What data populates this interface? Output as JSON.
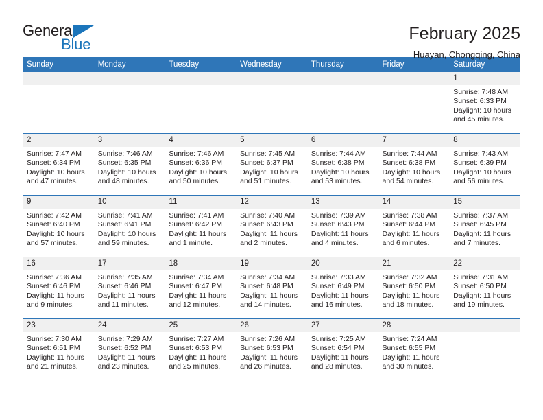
{
  "brand": {
    "name_part1": "General",
    "name_part2": "Blue"
  },
  "header": {
    "title": "February 2025",
    "subtitle": "Huayan, Chongqing, China"
  },
  "theme": {
    "header_blue": "#2f76b8",
    "brand_blue": "#1b75bb",
    "daynum_band": "#f0f0f0",
    "text": "#231f20"
  },
  "weekdays": [
    "Sunday",
    "Monday",
    "Tuesday",
    "Wednesday",
    "Thursday",
    "Friday",
    "Saturday"
  ],
  "weeks": [
    [
      {
        "day": "",
        "empty": true
      },
      {
        "day": "",
        "empty": true
      },
      {
        "day": "",
        "empty": true
      },
      {
        "day": "",
        "empty": true
      },
      {
        "day": "",
        "empty": true
      },
      {
        "day": "",
        "empty": true
      },
      {
        "day": "1",
        "sunrise": "Sunrise: 7:48 AM",
        "sunset": "Sunset: 6:33 PM",
        "daylight": "Daylight: 10 hours and 45 minutes."
      }
    ],
    [
      {
        "day": "2",
        "sunrise": "Sunrise: 7:47 AM",
        "sunset": "Sunset: 6:34 PM",
        "daylight": "Daylight: 10 hours and 47 minutes."
      },
      {
        "day": "3",
        "sunrise": "Sunrise: 7:46 AM",
        "sunset": "Sunset: 6:35 PM",
        "daylight": "Daylight: 10 hours and 48 minutes."
      },
      {
        "day": "4",
        "sunrise": "Sunrise: 7:46 AM",
        "sunset": "Sunset: 6:36 PM",
        "daylight": "Daylight: 10 hours and 50 minutes."
      },
      {
        "day": "5",
        "sunrise": "Sunrise: 7:45 AM",
        "sunset": "Sunset: 6:37 PM",
        "daylight": "Daylight: 10 hours and 51 minutes."
      },
      {
        "day": "6",
        "sunrise": "Sunrise: 7:44 AM",
        "sunset": "Sunset: 6:38 PM",
        "daylight": "Daylight: 10 hours and 53 minutes."
      },
      {
        "day": "7",
        "sunrise": "Sunrise: 7:44 AM",
        "sunset": "Sunset: 6:38 PM",
        "daylight": "Daylight: 10 hours and 54 minutes."
      },
      {
        "day": "8",
        "sunrise": "Sunrise: 7:43 AM",
        "sunset": "Sunset: 6:39 PM",
        "daylight": "Daylight: 10 hours and 56 minutes."
      }
    ],
    [
      {
        "day": "9",
        "sunrise": "Sunrise: 7:42 AM",
        "sunset": "Sunset: 6:40 PM",
        "daylight": "Daylight: 10 hours and 57 minutes."
      },
      {
        "day": "10",
        "sunrise": "Sunrise: 7:41 AM",
        "sunset": "Sunset: 6:41 PM",
        "daylight": "Daylight: 10 hours and 59 minutes."
      },
      {
        "day": "11",
        "sunrise": "Sunrise: 7:41 AM",
        "sunset": "Sunset: 6:42 PM",
        "daylight": "Daylight: 11 hours and 1 minute."
      },
      {
        "day": "12",
        "sunrise": "Sunrise: 7:40 AM",
        "sunset": "Sunset: 6:43 PM",
        "daylight": "Daylight: 11 hours and 2 minutes."
      },
      {
        "day": "13",
        "sunrise": "Sunrise: 7:39 AM",
        "sunset": "Sunset: 6:43 PM",
        "daylight": "Daylight: 11 hours and 4 minutes."
      },
      {
        "day": "14",
        "sunrise": "Sunrise: 7:38 AM",
        "sunset": "Sunset: 6:44 PM",
        "daylight": "Daylight: 11 hours and 6 minutes."
      },
      {
        "day": "15",
        "sunrise": "Sunrise: 7:37 AM",
        "sunset": "Sunset: 6:45 PM",
        "daylight": "Daylight: 11 hours and 7 minutes."
      }
    ],
    [
      {
        "day": "16",
        "sunrise": "Sunrise: 7:36 AM",
        "sunset": "Sunset: 6:46 PM",
        "daylight": "Daylight: 11 hours and 9 minutes."
      },
      {
        "day": "17",
        "sunrise": "Sunrise: 7:35 AM",
        "sunset": "Sunset: 6:46 PM",
        "daylight": "Daylight: 11 hours and 11 minutes."
      },
      {
        "day": "18",
        "sunrise": "Sunrise: 7:34 AM",
        "sunset": "Sunset: 6:47 PM",
        "daylight": "Daylight: 11 hours and 12 minutes."
      },
      {
        "day": "19",
        "sunrise": "Sunrise: 7:34 AM",
        "sunset": "Sunset: 6:48 PM",
        "daylight": "Daylight: 11 hours and 14 minutes."
      },
      {
        "day": "20",
        "sunrise": "Sunrise: 7:33 AM",
        "sunset": "Sunset: 6:49 PM",
        "daylight": "Daylight: 11 hours and 16 minutes."
      },
      {
        "day": "21",
        "sunrise": "Sunrise: 7:32 AM",
        "sunset": "Sunset: 6:50 PM",
        "daylight": "Daylight: 11 hours and 18 minutes."
      },
      {
        "day": "22",
        "sunrise": "Sunrise: 7:31 AM",
        "sunset": "Sunset: 6:50 PM",
        "daylight": "Daylight: 11 hours and 19 minutes."
      }
    ],
    [
      {
        "day": "23",
        "sunrise": "Sunrise: 7:30 AM",
        "sunset": "Sunset: 6:51 PM",
        "daylight": "Daylight: 11 hours and 21 minutes."
      },
      {
        "day": "24",
        "sunrise": "Sunrise: 7:29 AM",
        "sunset": "Sunset: 6:52 PM",
        "daylight": "Daylight: 11 hours and 23 minutes."
      },
      {
        "day": "25",
        "sunrise": "Sunrise: 7:27 AM",
        "sunset": "Sunset: 6:53 PM",
        "daylight": "Daylight: 11 hours and 25 minutes."
      },
      {
        "day": "26",
        "sunrise": "Sunrise: 7:26 AM",
        "sunset": "Sunset: 6:53 PM",
        "daylight": "Daylight: 11 hours and 26 minutes."
      },
      {
        "day": "27",
        "sunrise": "Sunrise: 7:25 AM",
        "sunset": "Sunset: 6:54 PM",
        "daylight": "Daylight: 11 hours and 28 minutes."
      },
      {
        "day": "28",
        "sunrise": "Sunrise: 7:24 AM",
        "sunset": "Sunset: 6:55 PM",
        "daylight": "Daylight: 11 hours and 30 minutes."
      },
      {
        "day": "",
        "empty": true
      }
    ]
  ]
}
